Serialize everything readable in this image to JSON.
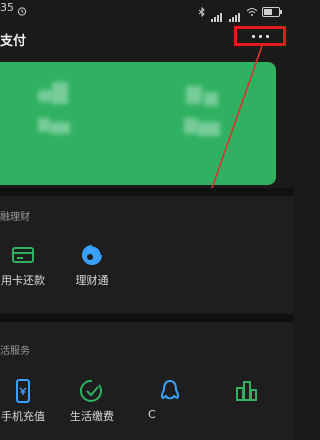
{
  "status": {
    "time": "35",
    "battery_level": 0.7,
    "alarm_icon": "alarm-icon",
    "bluetooth_icon": "bluetooth-icon",
    "wifi_icon": "wifi-icon"
  },
  "header": {
    "title": "支付",
    "more_icon": "more-horizontal-icon",
    "highlight_color": "#e11b1b"
  },
  "card": {
    "color": "#2fb161",
    "content": "blurred"
  },
  "finance": {
    "title": "融理财",
    "items": [
      {
        "label": "用卡还款",
        "icon": "card-icon",
        "color": "#2fb161"
      },
      {
        "label": "理财通",
        "icon": "licaitong-icon",
        "color": "#3aa0ff"
      }
    ]
  },
  "life": {
    "title": "活服务",
    "items": [
      {
        "label": "手机充值",
        "icon": "phone-icon",
        "color": "#3aa0ff"
      },
      {
        "label": "生活缴费",
        "icon": "check-circle-icon",
        "color": "#2fb161"
      },
      {
        "label": "C",
        "icon": "penguin-icon",
        "color": "#3aa0ff"
      },
      {
        "label": "",
        "icon": "city-icon",
        "color": "#2fb161"
      }
    ]
  }
}
